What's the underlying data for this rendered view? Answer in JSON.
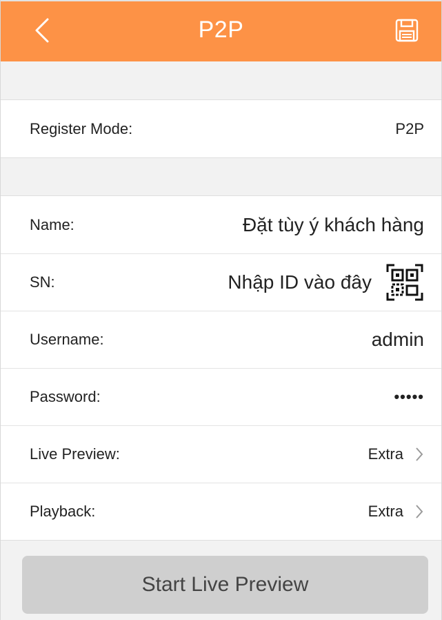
{
  "header": {
    "title": "P2P",
    "back_icon": "chevron-left-icon",
    "save_icon": "floppy-disk-icon",
    "background": "#fd9246"
  },
  "register": {
    "label": "Register Mode:",
    "value": "P2P"
  },
  "form": {
    "name": {
      "label": "Name:",
      "value": "Đặt tùy ý khách hàng"
    },
    "sn": {
      "label": "SN:",
      "value": "Nhập ID vào đây",
      "scan_icon": "qr-scan-icon"
    },
    "username": {
      "label": "Username:",
      "value": "admin"
    },
    "password": {
      "label": "Password:",
      "value": "•••••"
    },
    "live_preview": {
      "label": "Live Preview:",
      "value": "Extra"
    },
    "playback": {
      "label": "Playback:",
      "value": "Extra"
    }
  },
  "actions": {
    "start_label": "Start Live Preview"
  }
}
